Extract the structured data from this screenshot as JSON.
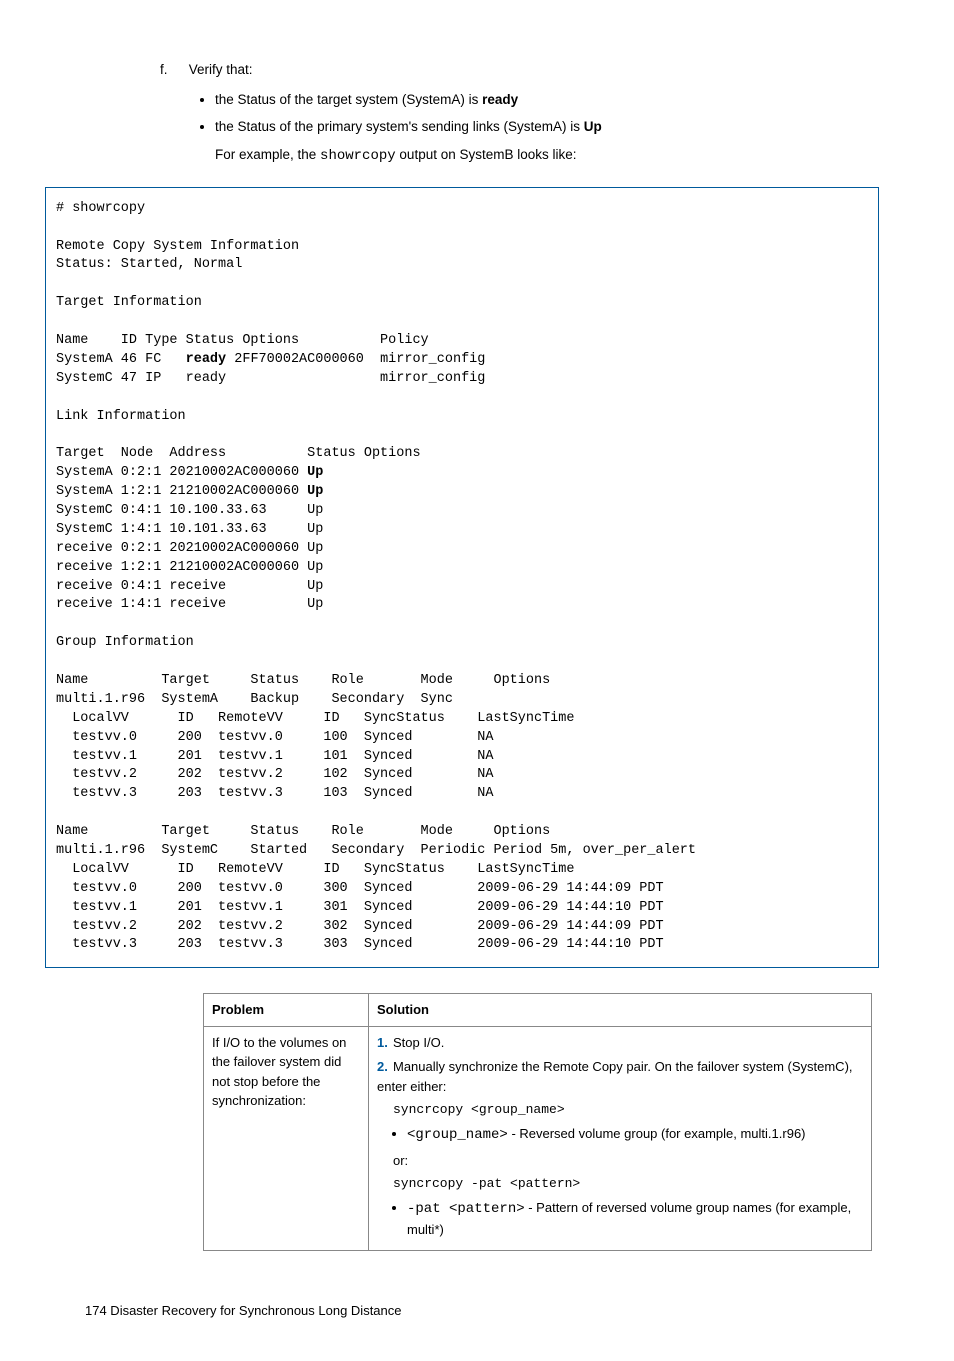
{
  "step": {
    "marker": "f.",
    "text": "Verify that:"
  },
  "bullets": [
    {
      "pre": "the Status of the target system (SystemA) is ",
      "bold": "ready"
    },
    {
      "pre": "the Status of the primary system's sending links (SystemA) is ",
      "bold": "Up"
    }
  ],
  "for_example": {
    "pre": "For example, the ",
    "cmd": "showrcopy",
    "post": " output on SystemB looks like:"
  },
  "terminal": {
    "l1": "# showrcopy",
    "l2": "Remote Copy System Information",
    "l3": "Status: Started, Normal",
    "l4": "Target Information",
    "l5": "Name    ID Type Status Options          Policy",
    "l6a": "SystemA 46 FC   ",
    "l6b": "ready",
    "l6c": " 2FF70002AC000060  mirror_config",
    "l7": "SystemC 47 IP   ready                   mirror_config",
    "l8": "Link Information",
    "l9": "Target  Node  Address          Status Options",
    "l10a": "SystemA 0:2:1 20210002AC000060 ",
    "l10b": "Up",
    "l11a": "SystemA 1:2:1 21210002AC000060 ",
    "l11b": "Up",
    "l12": "SystemC 0:4:1 10.100.33.63     Up",
    "l13": "SystemC 1:4:1 10.101.33.63     Up",
    "l14": "receive 0:2:1 20210002AC000060 Up",
    "l15": "receive 1:2:1 21210002AC000060 Up",
    "l16": "receive 0:4:1 receive          Up",
    "l17": "receive 1:4:1 receive          Up",
    "l18": "Group Information",
    "l19": "Name         Target     Status    Role       Mode     Options",
    "l20": "multi.1.r96  SystemA    Backup    Secondary  Sync",
    "l21": "  LocalVV      ID   RemoteVV     ID   SyncStatus    LastSyncTime",
    "l22": "  testvv.0     200  testvv.0     100  Synced        NA",
    "l23": "  testvv.1     201  testvv.1     101  Synced        NA",
    "l24": "  testvv.2     202  testvv.2     102  Synced        NA",
    "l25": "  testvv.3     203  testvv.3     103  Synced        NA",
    "l26": "Name         Target     Status    Role       Mode     Options",
    "l27": "multi.1.r96  SystemC    Started   Secondary  Periodic Period 5m, over_per_alert",
    "l28": "  LocalVV      ID   RemoteVV     ID   SyncStatus    LastSyncTime",
    "l29": "  testvv.0     200  testvv.0     300  Synced        2009-06-29 14:44:09 PDT",
    "l30": "  testvv.1     201  testvv.1     301  Synced        2009-06-29 14:44:10 PDT",
    "l31": "  testvv.2     202  testvv.2     302  Synced        2009-06-29 14:44:09 PDT",
    "l32": "  testvv.3     203  testvv.3     303  Synced        2009-06-29 14:44:10 PDT"
  },
  "table": {
    "headers": {
      "problem": "Problem",
      "solution": "Solution"
    },
    "problem_text": "If I/O to the volumes on the failover system did not stop before the synchronization:",
    "solution": {
      "item1": "Stop I/O.",
      "item2": "Manually synchronize the Remote Copy pair. On the failover system (SystemC), enter either:",
      "code1": "syncrcopy <group_name>",
      "bullet1_code": "<group_name>",
      "bullet1_text": " - Reversed volume group (for example, multi.1.r96)",
      "or": "or:",
      "code2": "syncrcopy -pat <pattern>",
      "bullet2_code": "-pat <pattern>",
      "bullet2_text": " - Pattern of reversed volume group names (for example, multi*)"
    }
  },
  "footer": "174   Disaster Recovery for Synchronous Long Distance"
}
